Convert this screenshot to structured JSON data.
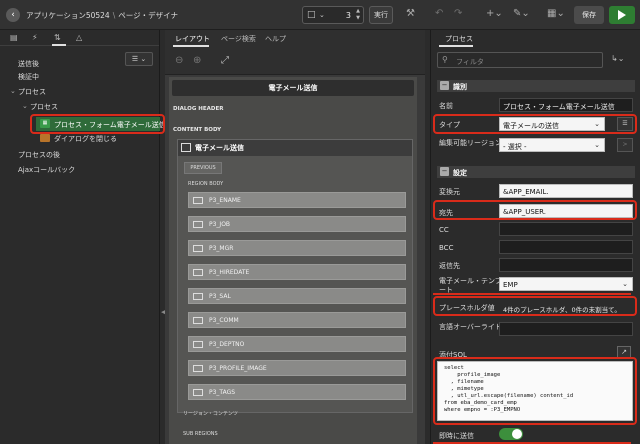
{
  "app": {
    "breadcrumb": [
      "アプリケーション50524",
      "ページ・デザイナ"
    ],
    "page_number": "3",
    "run_label": "実行",
    "save_label": "保存"
  },
  "left_panel": {
    "tree": [
      "送信後",
      "検証中",
      "プロセス",
      "プロセス",
      "プロセス・フォーム電子メール送信",
      "ダイアログを閉じる",
      "プロセスの後",
      "Ajaxコールバック"
    ]
  },
  "middle_panel": {
    "tabs": [
      "レイアウト",
      "ページ検索",
      "ヘルプ"
    ],
    "page_title": "電子メール送信",
    "sections": {
      "dialog_header": "DIALOG HEADER",
      "content_body": "CONTENT BODY",
      "region_title": "電子メール送信",
      "previous": "PREVIOUS",
      "region_body": "REGION BODY",
      "region_content": "リージョン・コンテンツ",
      "sub_regions": "SUB REGIONS"
    },
    "items": [
      "P3_ENAME",
      "P3_JOB",
      "P3_MGR",
      "P3_HIREDATE",
      "P3_SAL",
      "P3_COMM",
      "P3_DEPTNO",
      "P3_PROFILE_IMAGE",
      "P3_TAGS"
    ]
  },
  "right_panel": {
    "tab": "プロセス",
    "filter_placeholder": "フィルタ",
    "group_identification": "識別",
    "group_settings": "設定",
    "labels": {
      "name": "名前",
      "type": "タイプ",
      "editable_region": "編集可能リージョン",
      "from": "変換元",
      "to": "宛先",
      "cc": "CC",
      "bcc": "BCC",
      "reply_to": "返信先",
      "email_template_1": "電子メール・テンプレ",
      "email_template_2": "ート",
      "placeholder_values": "プレースホルダ値",
      "language_override": "言語オーバーライド",
      "attachment_sql": "添付SQL",
      "send_immediately": "即時に送信"
    },
    "values": {
      "name": "プロセス・フォーム電子メール送信",
      "type": "電子メールの送信",
      "editable_region": "- 選択 -",
      "from": "&APP_EMAIL.",
      "to": "&APP_USER.",
      "cc": "",
      "bcc": "",
      "reply_to": "",
      "email_template": "EMP",
      "placeholder_values": "4件のプレースホルダ、0件の未割当て。",
      "language_override": "",
      "attachment_sql": "select\n    profile_image\n  , filename\n  , mimetype\n  , utl_url.escape(filename) content_id\nfrom eba_demo_card_emp\nwhere empno = :P3_EMPNO"
    }
  }
}
